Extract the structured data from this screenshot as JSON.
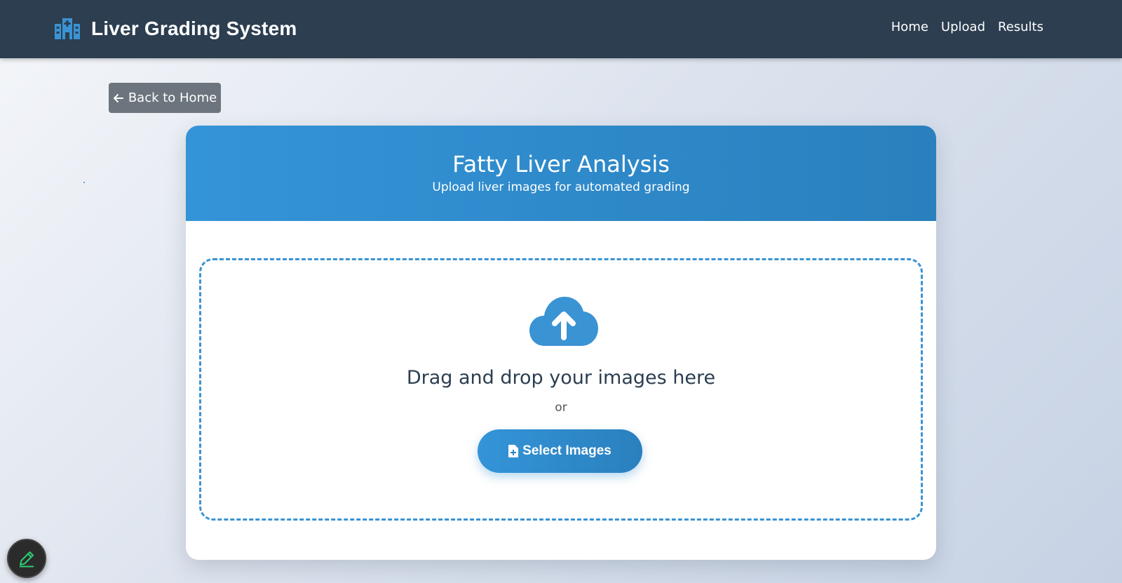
{
  "navbar": {
    "brand_icon": "hospital-icon",
    "title": "Liver Grading System",
    "links": [
      {
        "label": "Home"
      },
      {
        "label": "Upload"
      },
      {
        "label": "Results"
      }
    ]
  },
  "back_button": {
    "icon": "arrow-left-icon",
    "label": "Back to Home"
  },
  "card": {
    "title": "Fatty Liver Analysis",
    "subtitle": "Upload liver images for automated grading",
    "dropzone": {
      "icon": "cloud-upload-icon",
      "instruction": "Drag and drop your images here",
      "or": "or",
      "select_button": {
        "icon": "file-plus-icon",
        "label": "Select Images"
      }
    }
  },
  "fab": {
    "icon": "pencil-icon"
  },
  "colors": {
    "navbar": "#2c3e50",
    "accent": "#3494d8",
    "back_button": "#6c757d",
    "edit_icon": "#2ecc71"
  }
}
